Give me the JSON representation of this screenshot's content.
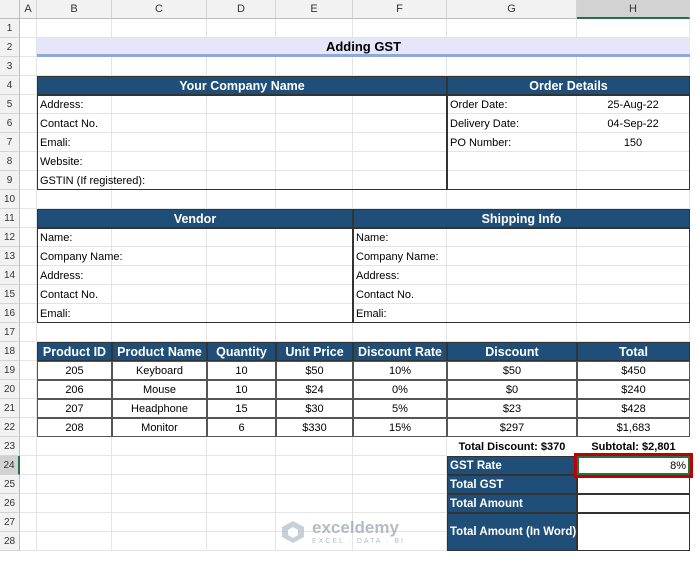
{
  "columns": [
    "A",
    "B",
    "C",
    "D",
    "E",
    "F",
    "G",
    "H"
  ],
  "rows": [
    "1",
    "2",
    "3",
    "4",
    "5",
    "6",
    "7",
    "8",
    "9",
    "10",
    "11",
    "12",
    "13",
    "14",
    "15",
    "16",
    "17",
    "18",
    "19",
    "20",
    "21",
    "22",
    "23",
    "24",
    "25",
    "26",
    "27",
    "28"
  ],
  "title": "Adding GST",
  "company": {
    "header": "Your Company Name",
    "labels": [
      "Address:",
      "Contact No.",
      "Emali:",
      "Website:",
      "GSTIN (If registered):"
    ]
  },
  "order": {
    "header": "Order Details",
    "labels": [
      "Order Date:",
      "Delivery Date:",
      "PO Number:"
    ],
    "values": [
      "25-Aug-22",
      "04-Sep-22",
      "150"
    ]
  },
  "vendor": {
    "header": "Vendor",
    "labels": [
      "Name:",
      "Company Name:",
      "Address:",
      "Contact No.",
      "Emali:"
    ]
  },
  "shipping": {
    "header": "Shipping Info",
    "labels": [
      "Name:",
      "Company Name:",
      "Address:",
      "Contact No.",
      "Emali:"
    ]
  },
  "table": {
    "headers": [
      "Product ID",
      "Product Name",
      "Quantity",
      "Unit Price",
      "Discount Rate",
      "Discount",
      "Total"
    ],
    "rows": [
      [
        "205",
        "Keyboard",
        "10",
        "$50",
        "10%",
        "$50",
        "$450"
      ],
      [
        "206",
        "Mouse",
        "10",
        "$24",
        "0%",
        "$0",
        "$240"
      ],
      [
        "207",
        "Headphone",
        "15",
        "$30",
        "5%",
        "$23",
        "$428"
      ],
      [
        "208",
        "Monitor",
        "6",
        "$330",
        "15%",
        "$297",
        "$1,683"
      ]
    ]
  },
  "totals": {
    "total_discount": "Total Discount: $370",
    "subtotal": "Subtotal: $2,801"
  },
  "summary": {
    "labels": [
      "GST Rate",
      "Total GST",
      "Total Amount",
      "Total Amount (In Word)"
    ],
    "values": [
      "8%",
      "",
      "",
      ""
    ]
  },
  "watermark": {
    "name": "exceldemy",
    "tagline": "EXCEL · DATA · BI"
  },
  "colors": {
    "header_bg": "#1f4e78",
    "title_bg": "#e6e6fb",
    "highlight": "#c00000"
  }
}
